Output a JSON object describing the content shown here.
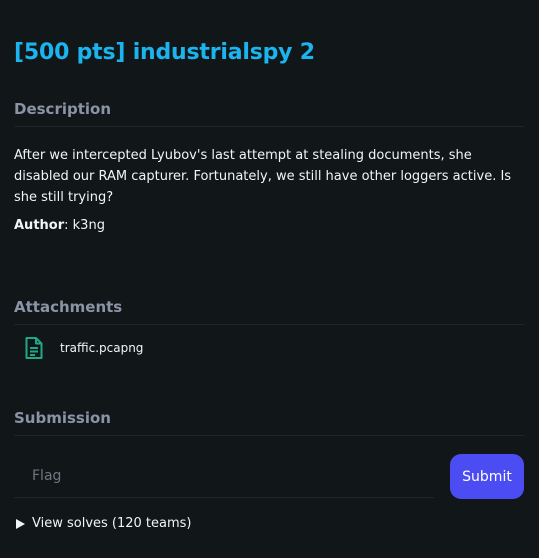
{
  "challenge": {
    "title": "[500 pts] industrialspy 2"
  },
  "description": {
    "heading": "Description",
    "text": "After we intercepted Lyubov's last attempt at stealing documents, she disabled our RAM capturer. Fortunately, we still have other loggers active. Is she still trying?",
    "author_label": "Author",
    "author_value": ": k3ng"
  },
  "attachments": {
    "heading": "Attachments",
    "items": [
      {
        "name": "traffic.pcapng",
        "icon": "file-document-icon"
      }
    ]
  },
  "submission": {
    "heading": "Submission",
    "flag_placeholder": "Flag",
    "flag_value": "",
    "submit_label": "Submit",
    "view_solves_label": "View solves (120 teams)"
  },
  "colors": {
    "background": "#111719",
    "title": "#1cb4ef",
    "heading": "#8b93a6",
    "accent_button": "#4b4cf1",
    "file_icon": "#1fa886"
  }
}
